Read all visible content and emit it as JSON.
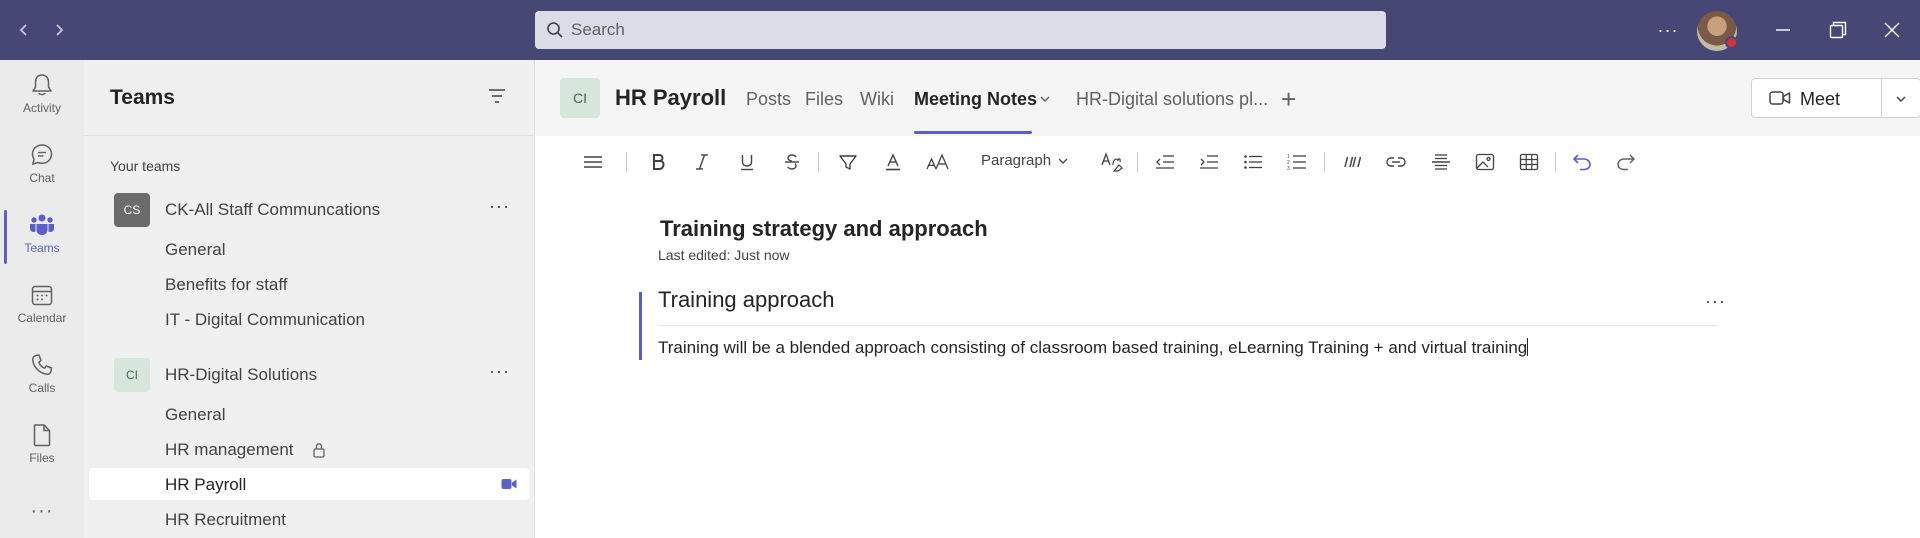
{
  "titlebar": {
    "search_placeholder": "Search",
    "more_label": "···"
  },
  "rail": {
    "items": [
      {
        "label": "Activity",
        "icon": "bell-icon"
      },
      {
        "label": "Chat",
        "icon": "chat-icon"
      },
      {
        "label": "Teams",
        "icon": "teams-icon",
        "active": true
      },
      {
        "label": "Calendar",
        "icon": "calendar-icon"
      },
      {
        "label": "Calls",
        "icon": "phone-icon"
      },
      {
        "label": "Files",
        "icon": "file-icon"
      }
    ],
    "more": "···"
  },
  "teams_panel": {
    "title": "Teams",
    "section_label": "Your teams",
    "teams": [
      {
        "badge": "CS",
        "badge_bg": "#6b6b6b",
        "badge_fg": "#ffffff",
        "name": "CK-All Staff Communcations",
        "more": "···",
        "channels": [
          "General",
          "Benefits for staff",
          "IT - Digital Communication"
        ]
      },
      {
        "badge": "CI",
        "badge_bg": "#d6e6dd",
        "badge_fg": "#3d6b50",
        "name": "HR-Digital Solutions",
        "more": "···",
        "channels": [
          "General",
          "HR management",
          "HR Payroll",
          "HR Recruitment"
        ]
      }
    ]
  },
  "channel_header": {
    "badge": "CI",
    "title": "HR Payroll",
    "tabs": [
      "Posts",
      "Files",
      "Wiki",
      "Meeting Notes",
      "HR-Digital solutions pl..."
    ],
    "add_tab": "+",
    "meet_label": "Meet"
  },
  "toolbar": {
    "paragraph_label": "Paragraph"
  },
  "document": {
    "title": "Training strategy and approach",
    "last_edited": "Last edited: Just now",
    "section_title": "Training approach",
    "section_more": "···",
    "section_body": "Training will be a blended approach consisting of classroom based training, eLearning Training + and virtual training"
  },
  "colors": {
    "titlebar": "#464775",
    "accent": "#5b5fc7"
  }
}
